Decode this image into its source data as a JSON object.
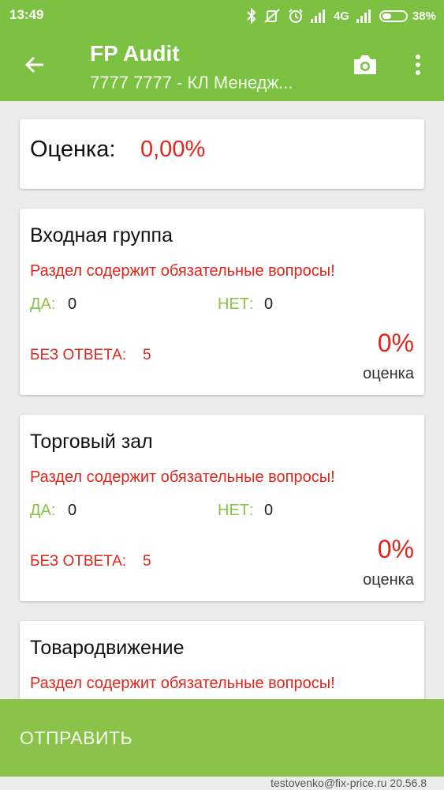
{
  "status_bar": {
    "time": "13:49",
    "network": "4G",
    "battery_percent_text": "38%",
    "battery_level": 0.38,
    "icons": [
      "bluetooth-icon",
      "mute-icon",
      "alarm-icon",
      "signal-icon",
      "signal-icon",
      "battery-icon"
    ]
  },
  "app_bar": {
    "title": "FP Audit",
    "subtitle": "7777 7777 - КЛ Менедж...",
    "back_icon": "arrow-back-icon",
    "camera_icon": "camera-icon",
    "more_icon": "more-vert-icon"
  },
  "score": {
    "label": "Оценка:",
    "value": "0,00%"
  },
  "sections": [
    {
      "title": "Входная группа",
      "warning": "Раздел содержит обязательные вопросы!",
      "yes_label": "ДА:",
      "yes_value": "0",
      "no_label": "НЕТ:",
      "no_value": "0",
      "unanswered_label": "БЕЗ ОТВЕТА:",
      "unanswered_value": "5",
      "percent": "0%",
      "percent_label": "оценка"
    },
    {
      "title": "Торговый зал",
      "warning": "Раздел содержит обязательные вопросы!",
      "yes_label": "ДА:",
      "yes_value": "0",
      "no_label": "НЕТ:",
      "no_value": "0",
      "unanswered_label": "БЕЗ ОТВЕТА:",
      "unanswered_value": "5",
      "percent": "0%",
      "percent_label": "оценка"
    },
    {
      "title": "Товародвижение",
      "warning": "Раздел содержит обязательные вопросы!"
    }
  ],
  "submit_button": {
    "label": "ОТПРАВИТЬ"
  },
  "footer": {
    "text": "testovenko@fix-price.ru  20.56.8"
  },
  "colors": {
    "primary": "#7cc142",
    "submit": "#8bc34a",
    "error": "#e0251b",
    "positive": "#8bc34a",
    "background": "#ececec"
  }
}
